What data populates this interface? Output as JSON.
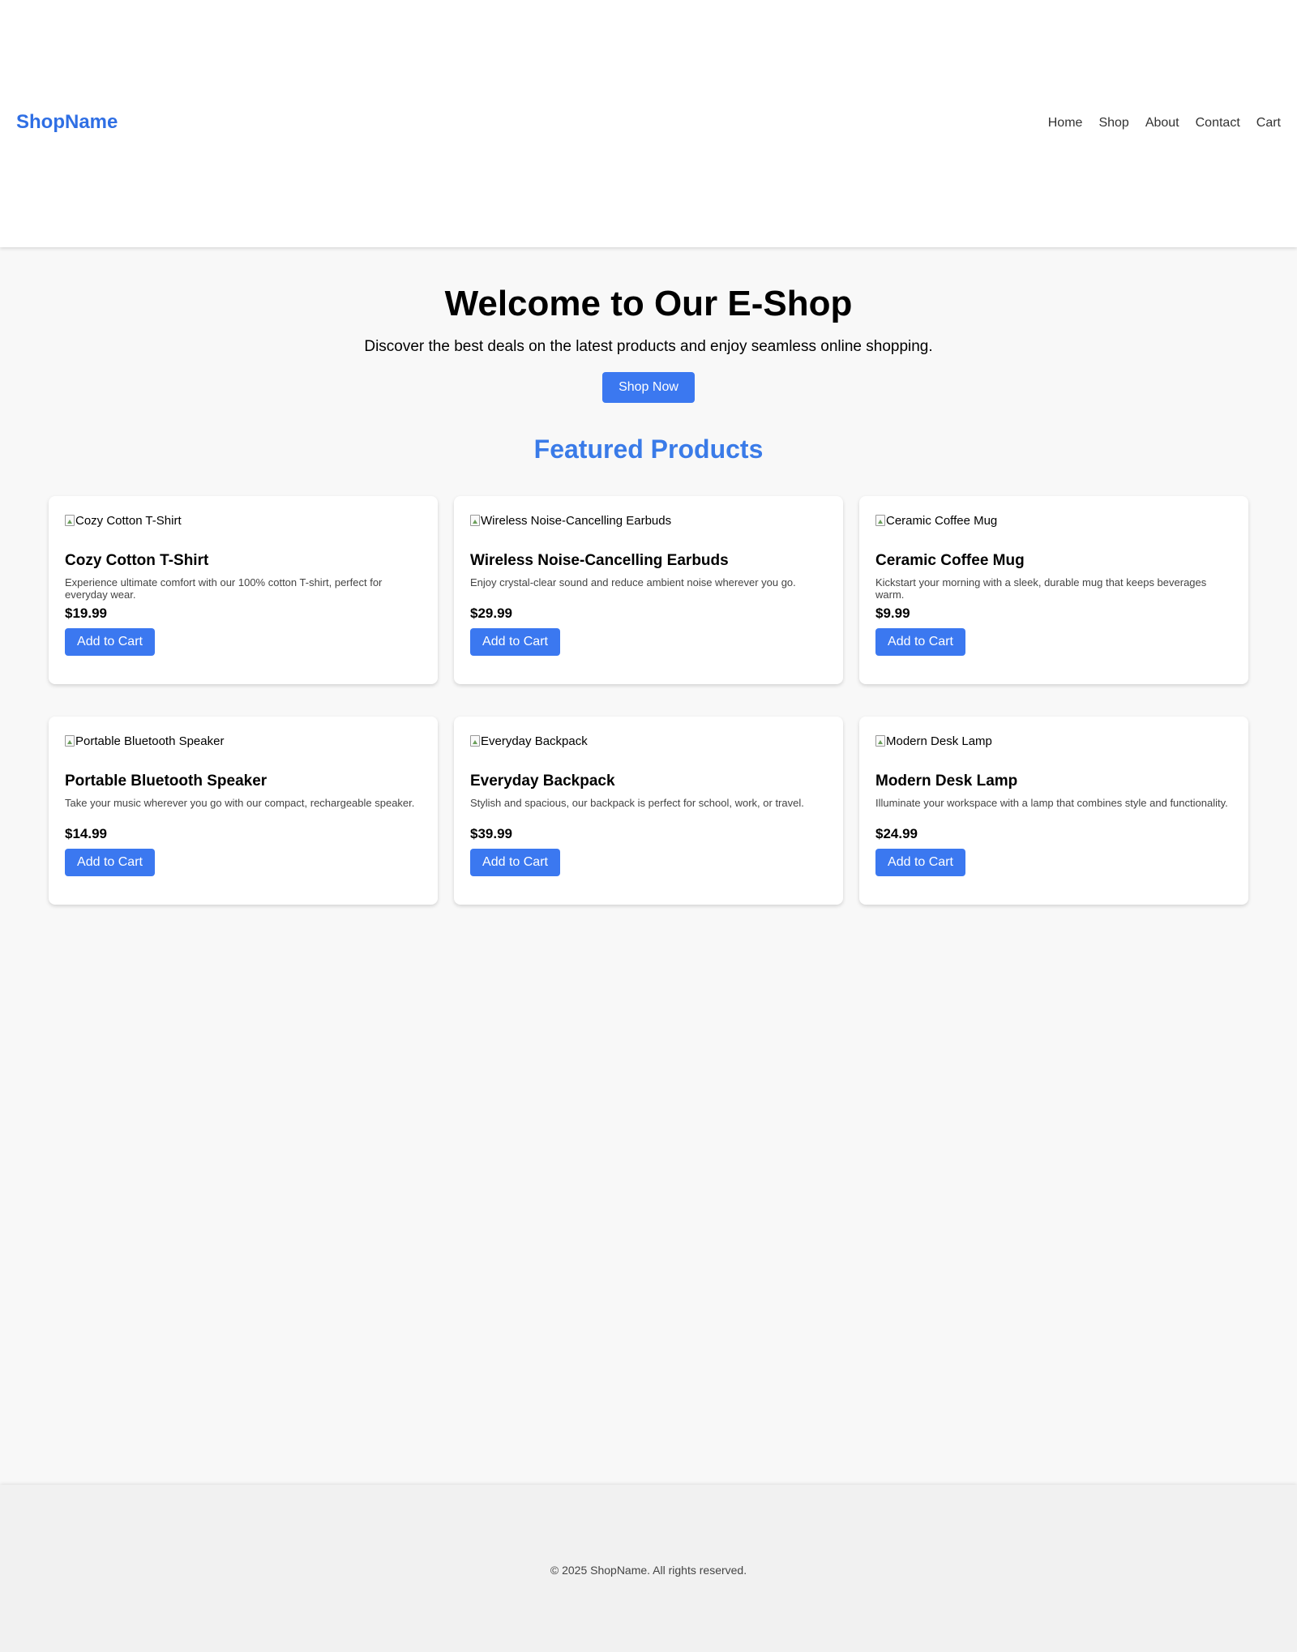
{
  "header": {
    "logo": "ShopName",
    "nav": [
      {
        "label": "Home"
      },
      {
        "label": "Shop"
      },
      {
        "label": "About"
      },
      {
        "label": "Contact"
      },
      {
        "label": "Cart"
      }
    ]
  },
  "hero": {
    "title": "Welcome to Our E-Shop",
    "subtitle": "Discover the best deals on the latest products and enjoy seamless online shopping.",
    "cta_label": "Shop Now"
  },
  "featured": {
    "title": "Featured Products",
    "products": [
      {
        "image_alt": "Cozy Cotton T-Shirt",
        "name": "Cozy Cotton T-Shirt",
        "description": "Experience ultimate comfort with our 100% cotton T-shirt, perfect for everyday wear.",
        "price": "$19.99",
        "button_label": "Add to Cart"
      },
      {
        "image_alt": "Wireless Noise-Cancelling Earbuds",
        "name": "Wireless Noise-Cancelling Earbuds",
        "description": "Enjoy crystal-clear sound and reduce ambient noise wherever you go.",
        "price": "$29.99",
        "button_label": "Add to Cart"
      },
      {
        "image_alt": "Ceramic Coffee Mug",
        "name": "Ceramic Coffee Mug",
        "description": "Kickstart your morning with a sleek, durable mug that keeps beverages warm.",
        "price": "$9.99",
        "button_label": "Add to Cart"
      },
      {
        "image_alt": "Portable Bluetooth Speaker",
        "name": "Portable Bluetooth Speaker",
        "description": "Take your music wherever you go with our compact, rechargeable speaker.",
        "price": "$14.99",
        "button_label": "Add to Cart"
      },
      {
        "image_alt": "Everyday Backpack",
        "name": "Everyday Backpack",
        "description": "Stylish and spacious, our backpack is perfect for school, work, or travel.",
        "price": "$39.99",
        "button_label": "Add to Cart"
      },
      {
        "image_alt": "Modern Desk Lamp",
        "name": "Modern Desk Lamp",
        "description": "Illuminate your workspace with a lamp that combines style and functionality.",
        "price": "$24.99",
        "button_label": "Add to Cart"
      }
    ]
  },
  "footer": {
    "copyright": "© 2025 ShopName. All rights reserved."
  },
  "colors": {
    "brand": "#2f6fe4",
    "button": "#3b78f0",
    "page_background": "#f8f8f8",
    "footer_background": "#f1f1f1"
  }
}
